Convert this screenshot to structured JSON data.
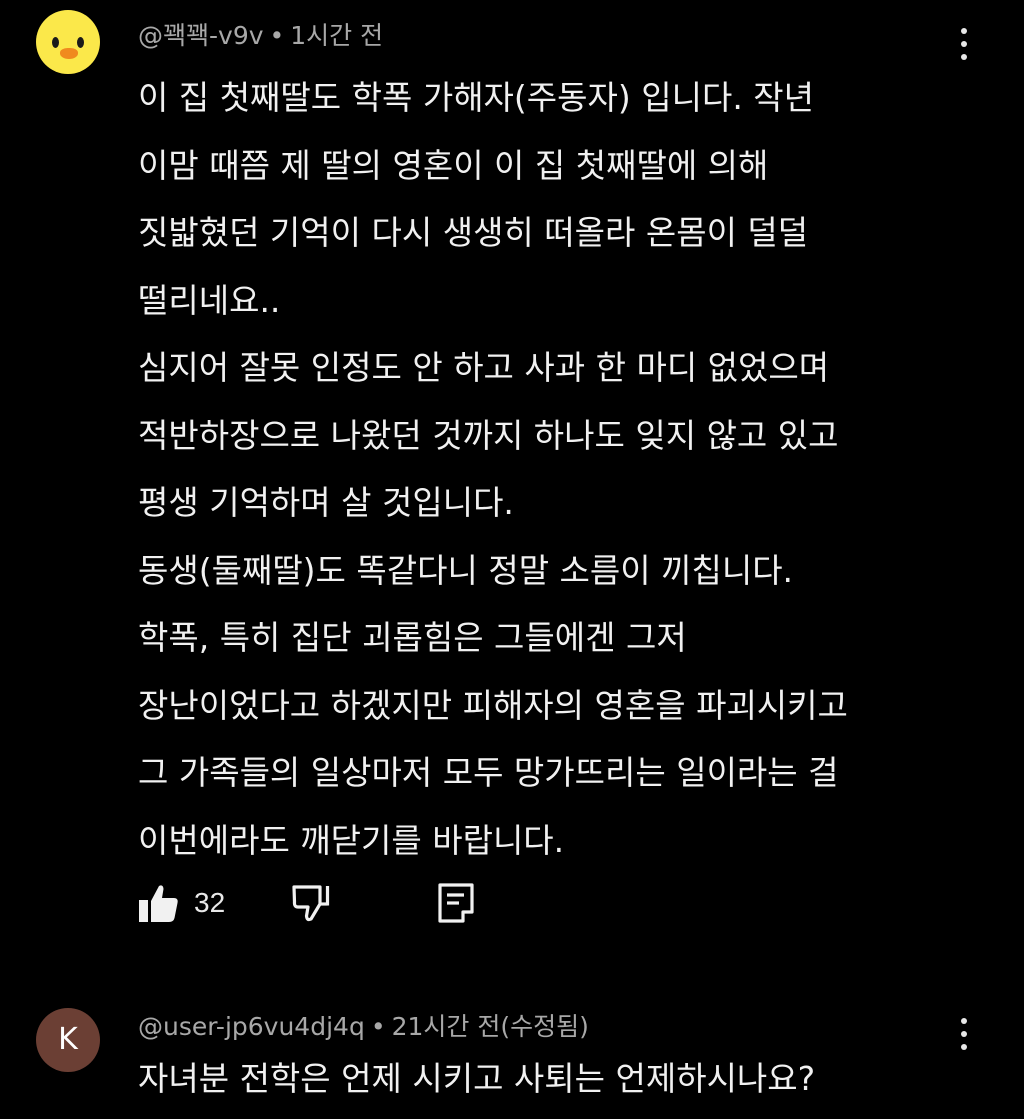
{
  "comments": [
    {
      "author": "@꽥꽥-v9v",
      "separator": "•",
      "time": "1시간 전",
      "avatar_icon": "duck-avatar",
      "lines": [
        "이 집 첫째딸도 학폭 가해자(주동자) 입니다. 작년",
        "이맘 때쯤 제 딸의 영혼이 이 집 첫째딸에 의해",
        "짓밟혔던 기억이 다시 생생히 떠올라 온몸이 덜덜",
        "떨리네요..",
        "심지어 잘못 인정도 안 하고 사과 한 마디 없었으며",
        "적반하장으로 나왔던 것까지 하나도 잊지 않고 있고",
        "평생 기억하며 살 것입니다.",
        "동생(둘째딸)도 똑같다니 정말 소름이 끼칩니다.",
        "학폭, 특히 집단 괴롭힘은 그들에겐 그저",
        "장난이었다고 하겠지만 피해자의 영혼을 파괴시키고",
        "그 가족들의 일상마저 모두 망가뜨리는 일이라는 걸",
        "이번에라도 깨닫기를 바랍니다."
      ],
      "like_count": "32",
      "icons": {
        "like": "thumbs-up-icon",
        "dislike": "thumbs-down-icon",
        "reply": "reply-icon",
        "menu": "more-vertical-icon"
      }
    },
    {
      "author": "@user-jp6vu4dj4q",
      "separator": "•",
      "time": "21시간 전(수정됨)",
      "avatar_letter": "K",
      "lines": [
        "자녀분 전학은 언제 시키고 사퇴는 언제하시나요?"
      ]
    }
  ],
  "colors": {
    "background": "#000000",
    "text": "#f1f1f1",
    "meta": "#a8a8a8",
    "duck_avatar": "#fbe84a",
    "letter_avatar": "#6b3f34"
  }
}
